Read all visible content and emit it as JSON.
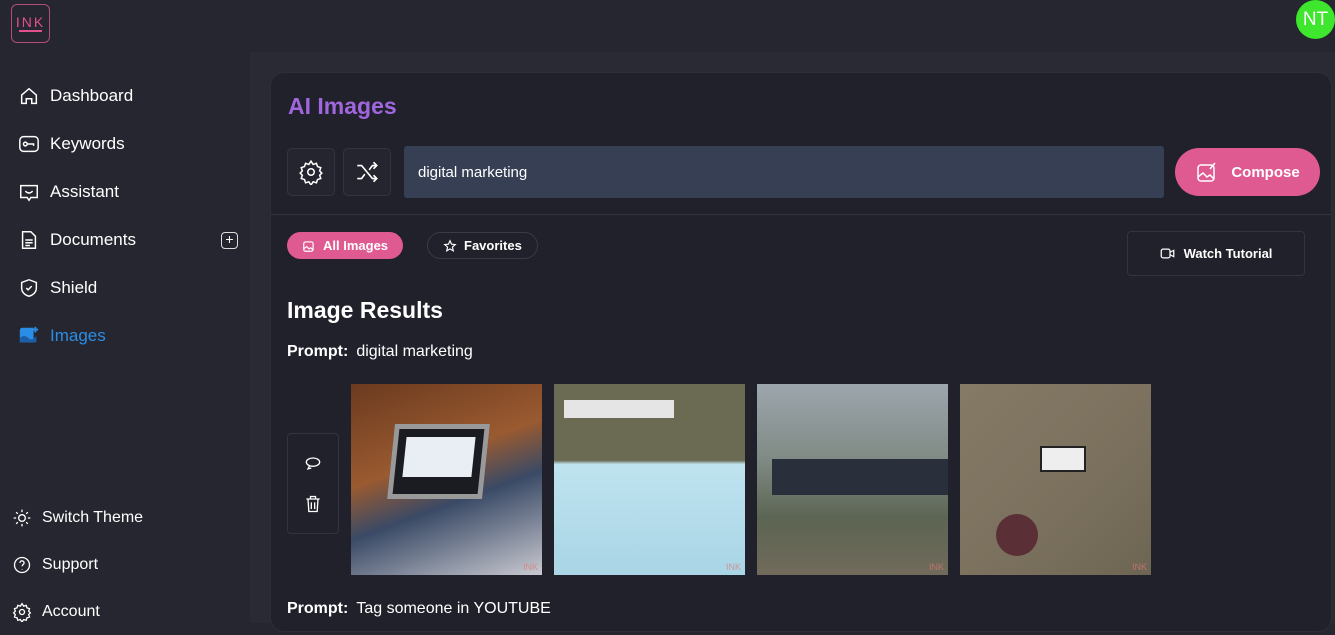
{
  "app": {
    "logo": "INK",
    "avatar_initials": "NT"
  },
  "sidebar": {
    "items": [
      {
        "label": "Dashboard",
        "icon": "home-icon"
      },
      {
        "label": "Keywords",
        "icon": "key-icon"
      },
      {
        "label": "Assistant",
        "icon": "chat-icon"
      },
      {
        "label": "Documents",
        "icon": "document-icon"
      },
      {
        "label": "Shield",
        "icon": "shield-icon"
      },
      {
        "label": "Images",
        "icon": "images-icon",
        "active": true
      }
    ],
    "bottom": [
      {
        "label": "Switch Theme",
        "icon": "sun-icon"
      },
      {
        "label": "Support",
        "icon": "help-icon"
      },
      {
        "label": "Account",
        "icon": "gear-icon"
      }
    ]
  },
  "main": {
    "title": "AI Images",
    "search": {
      "value": "digital marketing"
    },
    "compose_label": "Compose",
    "tabs": [
      {
        "label": "All Images",
        "active": true
      },
      {
        "label": "Favorites"
      }
    ],
    "tutorial_label": "Watch Tutorial",
    "results_title": "Image Results",
    "prompt_label": "Prompt:",
    "groups": [
      {
        "prompt": "digital marketing",
        "images": 4
      },
      {
        "prompt": "Tag someone in YOUTUBE"
      }
    ],
    "watermark": "INK"
  },
  "colors": {
    "accent": "#e05a92",
    "title": "#a066dd",
    "active_nav": "#2a8ee6",
    "avatar": "#3ee62d"
  }
}
